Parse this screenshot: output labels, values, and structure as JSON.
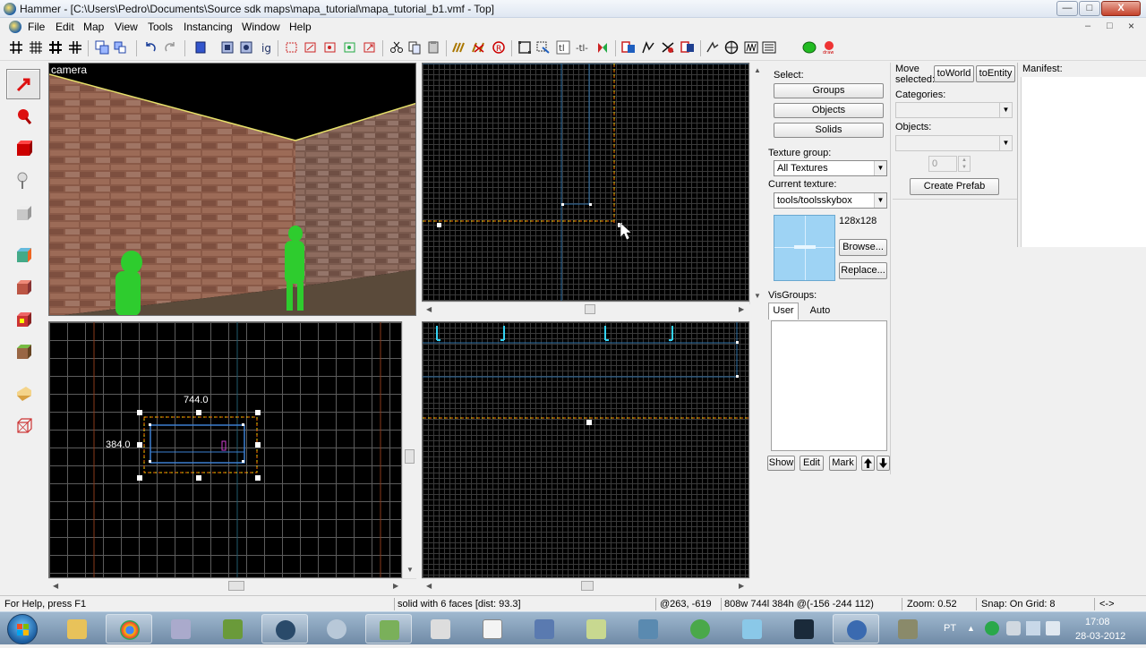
{
  "window": {
    "title": "Hammer - [C:\\Users\\Pedro\\Documents\\Source sdk maps\\mapa_tutorial\\mapa_tutorial_b1.vmf - Top]",
    "min_label": "—",
    "max_label": "□",
    "close_label": "X"
  },
  "menu": {
    "items": [
      "File",
      "Edit",
      "Map",
      "View",
      "Tools",
      "Instancing",
      "Window",
      "Help"
    ],
    "mdi_min": "–",
    "mdi_max": "□",
    "mdi_close": "×"
  },
  "toolbar": {
    "icons": [
      "grid-icon",
      "grid-smaller-icon",
      "grid-larger-icon",
      "grid-snap-icon",
      "texture-lock-icon",
      "group-icon",
      "ungroup-icon",
      "undo-icon",
      "redo-icon",
      "carve-icon",
      "hide-icon",
      "show-icon",
      "entity-report-icon",
      "check-map-icon",
      "compile-icon",
      "clip-icon",
      "vertex-icon",
      "transform-icon",
      "texture-icon",
      "decal-icon",
      "overlay-icon",
      "autovis-icon",
      "cordon-icon",
      "wireframe-icon",
      "helpers-icon",
      "cm-icon",
      "run-map-icon",
      "draw-icon"
    ],
    "cm_label": "CM"
  },
  "tools": [
    "selection-tool-icon",
    "magnify-tool-icon",
    "camera-tool-icon",
    "entity-tool-icon",
    "block-tool-icon",
    "texture-application-icon",
    "apply-texture-icon",
    "decal-tool-icon",
    "overlay-tool-icon",
    "clipping-tool-icon",
    "vertex-tool-icon",
    "path-tool-icon"
  ],
  "viewports": {
    "camera_label": "camera",
    "side_width": "744.0",
    "side_height": "384.0"
  },
  "select_panel": {
    "label": "Select:",
    "groups": "Groups",
    "objects": "Objects",
    "solids": "Solids"
  },
  "texture_panel": {
    "group_label": "Texture group:",
    "group_value": "All Textures",
    "current_label": "Current texture:",
    "current_value": "tools/toolsskybox",
    "size": "128x128",
    "browse": "Browse...",
    "replace": "Replace..."
  },
  "visgroups": {
    "label": "VisGroups:",
    "tab_user": "User",
    "tab_auto": "Auto",
    "show": "Show",
    "edit": "Edit",
    "mark": "Mark",
    "up": "🡅",
    "down": "🡇"
  },
  "move_panel": {
    "label_line1": "Move",
    "label_line2": "selected:",
    "to_world": "toWorld",
    "to_entity": "toEntity",
    "categories_label": "Categories:",
    "objects_label": "Objects:",
    "spin_value": "0",
    "create_prefab": "Create Prefab",
    "manifest_label": "Manifest:"
  },
  "status": {
    "help": "For Help, press F1",
    "selection": "solid with 6 faces  [dist: 93.3]",
    "cursor": "@263, -619",
    "size": "808w 744l 384h @(-156 -244 112)",
    "zoom": "Zoom: 0.52",
    "snap": "Snap: On Grid: 8",
    "extra": "<->"
  },
  "taskbar": {
    "apps": [
      "windows-explorer-icon",
      "chrome-icon",
      "ds-icon",
      "minecraft-icon",
      "steam-icon",
      "network-icon",
      "hammer-icon",
      "paper-icon",
      "notepad-icon",
      "paint-icon",
      "folder-icon",
      "security-icon",
      "utorrent-icon",
      "map-icon",
      "steam-icon-2",
      "globe-icon",
      "tool-icon"
    ],
    "lang": "PT",
    "time": "17:08",
    "date": "28-03-2012"
  }
}
